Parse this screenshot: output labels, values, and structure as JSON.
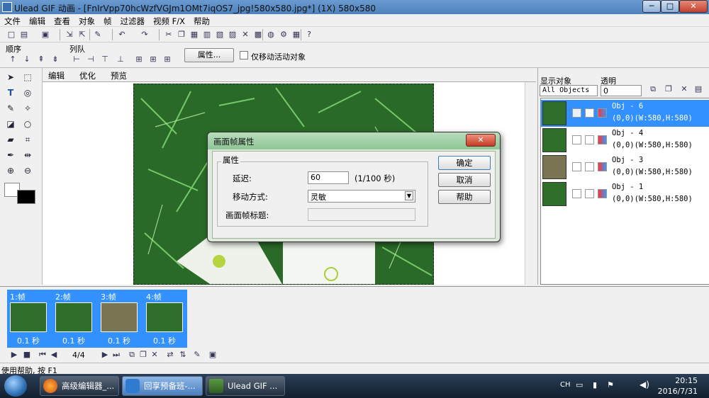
{
  "window": {
    "title": "Ulead GIF 动画 - [FnIrVpp70hcWzfVGJm1OMt7iqOS7_jpg!580x580.jpg*] (1X) 580x580",
    "min": "─",
    "max": "□",
    "close": "✕"
  },
  "menu": [
    "文件",
    "编辑",
    "查看",
    "对象",
    "帧",
    "过滤器",
    "视频 F/X",
    "帮助"
  ],
  "toolbar2": {
    "order_label": "顺序",
    "queue_label": "列队",
    "attr_button": "属性...",
    "move_active_label": "仅移动活动对象"
  },
  "tabs": [
    "编辑",
    "优化",
    "预览"
  ],
  "right": {
    "show_label": "显示对象",
    "transparent_label": "透明",
    "show_select": "All Objects",
    "opacity": "0"
  },
  "objects": [
    {
      "name": "Obj - 6",
      "info": "(0,0)(W:580,H:580)"
    },
    {
      "name": "Obj - 4",
      "info": "(0,0)(W:580,H:580)"
    },
    {
      "name": "Obj - 3",
      "info": "(0,0)(W:580,H:580)"
    },
    {
      "name": "Obj - 1",
      "info": "(0,0)(W:580,H:580)"
    }
  ],
  "frames": [
    {
      "label": "1:帧",
      "delay": "0.1 秒"
    },
    {
      "label": "2:帧",
      "delay": "0.1 秒"
    },
    {
      "label": "3:帧",
      "delay": "0.1 秒"
    },
    {
      "label": "4:帧",
      "delay": "0.1 秒"
    }
  ],
  "playbar": {
    "frame_counter": "4/4"
  },
  "dialog": {
    "title": "画面帧属性",
    "group": "属性",
    "delay_label": "延迟:",
    "delay_value": "60",
    "delay_unit": "(1/100 秒)",
    "move_label": "移动方式:",
    "move_value": "灵敏",
    "frame_title_label": "画面帧标题:",
    "ok": "确定",
    "cancel": "取消",
    "help": "帮助"
  },
  "status": "使用帮助, 按 F1",
  "taskbar": {
    "items": [
      "高级编辑器_...",
      "回享预备班-...",
      "Ulead GIF ..."
    ],
    "ime": "CH",
    "time": "20:15",
    "date": "2016/7/31"
  },
  "colors": {
    "selection": "#3390ff",
    "title_blue": "#4f82bd",
    "dialog_green": "#8ec695"
  }
}
